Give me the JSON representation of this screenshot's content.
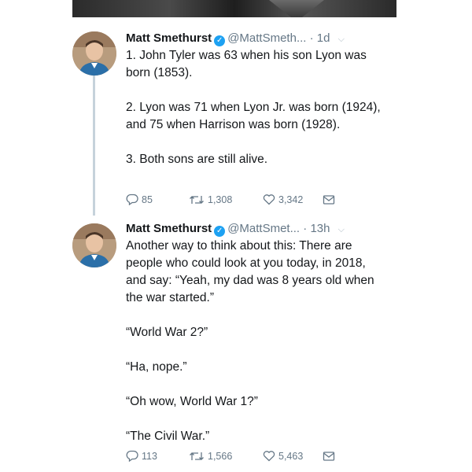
{
  "tweets": [
    {
      "name": "Matt Smethurst",
      "handle": "@MattSmeth...",
      "time": "· 1d",
      "paragraphs": [
        "1. John Tyler was 63 when his son Lyon was born (1853).",
        "2. Lyon was 71 when Lyon Jr. was born (1924), and 75 when Harrison was born (1928).",
        "3. Both sons are still alive."
      ],
      "replies": "85",
      "retweets": "1,308",
      "likes": "3,342"
    },
    {
      "name": "Matt Smethurst",
      "handle": "@MattSmet...",
      "time": "· 13h",
      "paragraphs": [
        "Another way to think about this: There are people who could look at you today, in 2018, and say: “Yeah, my dad was 8 years old when the war started.”",
        "“World War 2?”",
        "“Ha, nope.”",
        "“Oh wow, World War 1?”",
        "“The Civil War.”"
      ],
      "replies": "113",
      "retweets": "1,566",
      "likes": "5,463"
    }
  ],
  "icons": {
    "verified": "verified-badge-icon",
    "reply": "reply-icon",
    "retweet": "retweet-icon",
    "like": "heart-icon",
    "message": "direct-message-icon",
    "menu": "chevron-down-icon"
  },
  "colors": {
    "verified": "#1da1f2",
    "meta": "#657786",
    "thread_line": "#c6d2db"
  }
}
